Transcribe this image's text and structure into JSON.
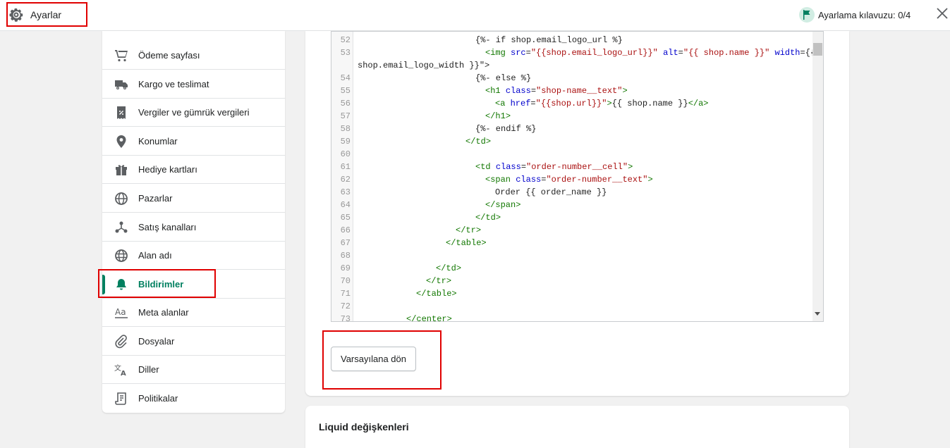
{
  "header": {
    "title": "Ayarlar",
    "guide_label": "Ayarlama kılavuzu: 0/4",
    "icons": {
      "settings": "gear-icon",
      "guide": "flag-icon",
      "close": "close-icon"
    }
  },
  "sidebar": {
    "items": [
      {
        "label": "Ödeme sayfası",
        "icon": "cart-icon"
      },
      {
        "label": "Kargo ve teslimat",
        "icon": "truck-icon"
      },
      {
        "label": "Vergiler ve gümrük vergileri",
        "icon": "receipt-icon"
      },
      {
        "label": "Konumlar",
        "icon": "location-pin-icon"
      },
      {
        "label": "Hediye kartları",
        "icon": "gift-icon"
      },
      {
        "label": "Pazarlar",
        "icon": "markets-icon"
      },
      {
        "label": "Satış kanalları",
        "icon": "channels-icon"
      },
      {
        "label": "Alan adı",
        "icon": "globe-icon"
      },
      {
        "label": "Bildirimler",
        "icon": "bell-icon",
        "active": true
      },
      {
        "label": "Meta alanlar",
        "icon": "metafields-icon"
      },
      {
        "label": "Dosyalar",
        "icon": "paperclip-icon"
      },
      {
        "label": "Diller",
        "icon": "translate-icon"
      },
      {
        "label": "Politikalar",
        "icon": "document-icon"
      }
    ]
  },
  "editor": {
    "lines": [
      {
        "n": "52",
        "t": "{%- if shop.email_logo_url %}"
      },
      {
        "n": "53",
        "t": "<img src=\"{{shop.email_logo_url}}\" alt=\"{{ shop.name }}\" width=\"{{"
      },
      {
        "n": "",
        "t": "shop.email_logo_width }}\">"
      },
      {
        "n": "54",
        "t": "{%- else %}"
      },
      {
        "n": "55",
        "t": "<h1 class=\"shop-name__text\">"
      },
      {
        "n": "56",
        "t": "<a href=\"{{shop.url}}\">{{ shop.name }}</a>"
      },
      {
        "n": "57",
        "t": "</h1>"
      },
      {
        "n": "58",
        "t": "{%- endif %}"
      },
      {
        "n": "59",
        "t": "</td>"
      },
      {
        "n": "60",
        "t": ""
      },
      {
        "n": "61",
        "t": "<td class=\"order-number__cell\">"
      },
      {
        "n": "62",
        "t": "<span class=\"order-number__text\">"
      },
      {
        "n": "63",
        "t": "Order {{ order_name }}"
      },
      {
        "n": "64",
        "t": "</span>"
      },
      {
        "n": "65",
        "t": "</td>"
      },
      {
        "n": "66",
        "t": "</tr>"
      },
      {
        "n": "67",
        "t": "</table>"
      },
      {
        "n": "68",
        "t": ""
      },
      {
        "n": "69",
        "t": "</td>"
      },
      {
        "n": "70",
        "t": "</tr>"
      },
      {
        "n": "71",
        "t": "</table>"
      },
      {
        "n": "72",
        "t": ""
      },
      {
        "n": "73",
        "t": "</center>"
      }
    ]
  },
  "actions": {
    "revert_label": "Varsayılana dön"
  },
  "liquid_card": {
    "title": "Liquid değişkenleri"
  },
  "colors": {
    "accent": "#008060",
    "highlight": "#e00000"
  }
}
